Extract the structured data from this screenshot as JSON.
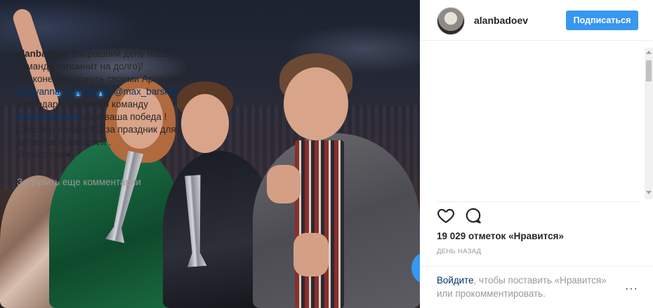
{
  "post": {
    "username": "alanbadoev",
    "follow_label": "Подписаться",
    "caption": {
      "author": "alanbadoev",
      "line1": "Вчерашний день наша",
      "line2": "команда запомнит на долго)!",
      "line3": "Бесконечно горжусь своими Артистами",
      "mention1": "@tayanna_reshetnyak",
      "mention2": "@max_barskih",
      "line5": "Благодарю любимую команду",
      "hashtag": "#secretservice",
      "line6_rest": " это и ваша победа !",
      "line7": "Спасибо каналу М1 за праздник для",
      "line8": "артистов и зрителей .",
      "line9": "Я счастлив",
      "heart": "♥"
    },
    "load_more_label": "Загрузить еще комментарии",
    "likes_text": "19 029 отметок «Нравится»",
    "timestamp": "день назад",
    "login_prompt": {
      "link": "Войдите",
      "text_rest": ", чтобы поставить «Нравится»",
      "line2": "или прокомментировать."
    },
    "more_options_label": "···"
  },
  "icons": {
    "like": "heart-outline-icon",
    "comment": "speech-bubble-icon",
    "more": "ellipsis-icon"
  },
  "colors": {
    "accent": "#3897f0",
    "link": "#003569",
    "muted": "#999999",
    "text": "#262626"
  }
}
